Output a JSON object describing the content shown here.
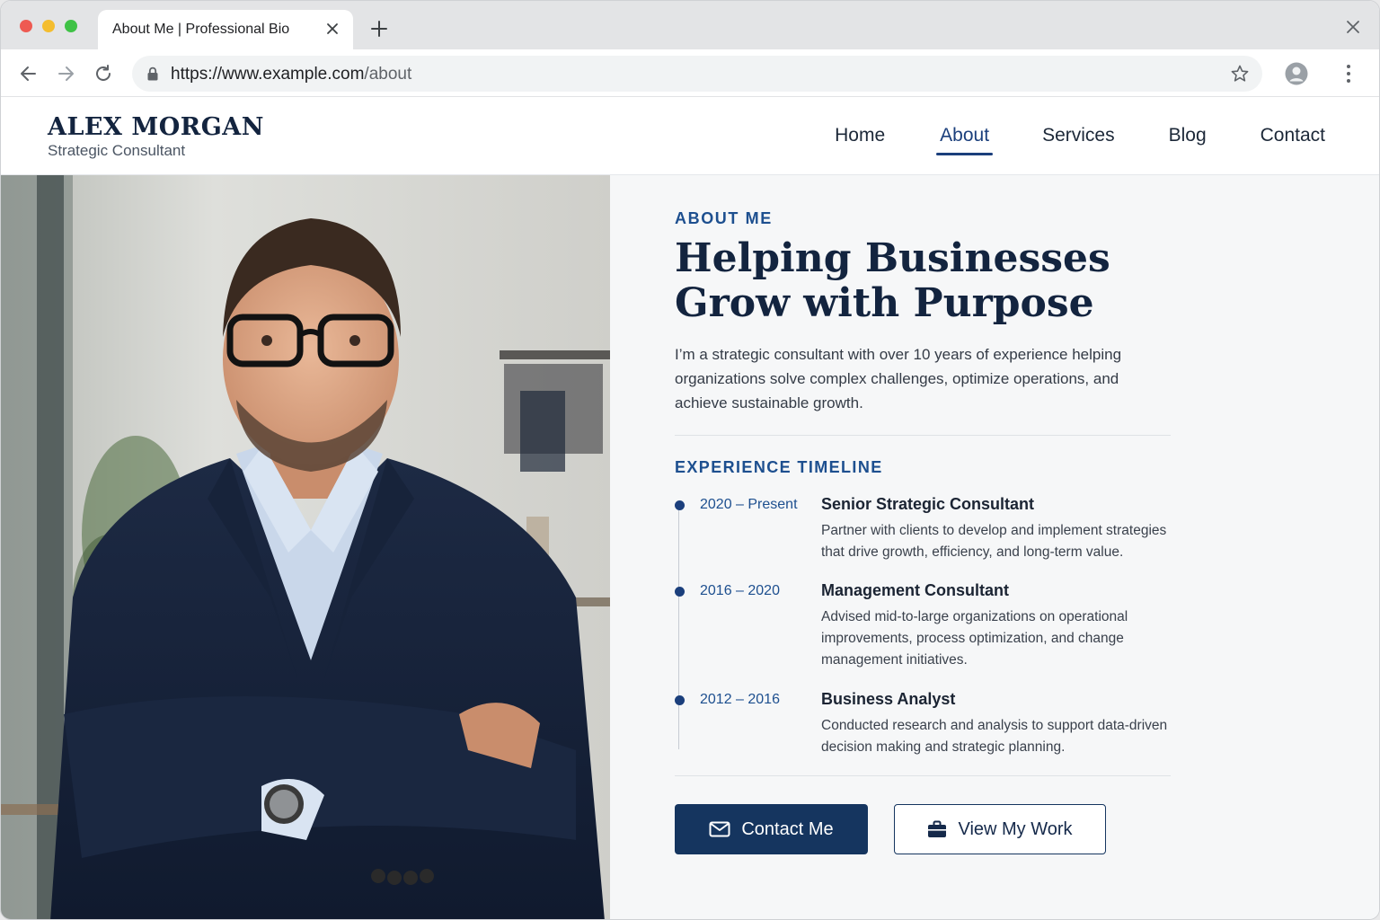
{
  "browser": {
    "tab_title": "About Me | Professional Bio",
    "url_host": "https://www.example.com",
    "url_path": "/about"
  },
  "site": {
    "name": "ALEX MORGAN",
    "role": "Strategic Consultant",
    "nav": [
      {
        "label": "Home",
        "active": false
      },
      {
        "label": "About",
        "active": true
      },
      {
        "label": "Services",
        "active": false
      },
      {
        "label": "Blog",
        "active": false
      },
      {
        "label": "Contact",
        "active": false
      }
    ]
  },
  "about": {
    "eyebrow": "ABOUT ME",
    "headline_line1": "Helping Businesses",
    "headline_line2": "Grow with Purpose",
    "intro": "I’m a strategic consultant with over 10 years of experience helping organizations solve complex challenges, optimize operations, and achieve sustainable growth."
  },
  "timeline": {
    "title": "EXPERIENCE TIMELINE",
    "items": [
      {
        "period": "2020 – Present",
        "role": "Senior Strategic Consultant",
        "desc": "Partner with clients to develop and implement strategies that drive growth, efficiency, and long-term value."
      },
      {
        "period": "2016 – 2020",
        "role": "Management Consultant",
        "desc": "Advised mid-to-large organizations on operational improvements, process optimization, and change management initiatives."
      },
      {
        "period": "2012 – 2016",
        "role": "Business Analyst",
        "desc": "Conducted research and analysis to support data-driven decision making and strategic planning."
      }
    ]
  },
  "actions": {
    "primary_label": "Contact Me",
    "primary_icon": "envelope-icon",
    "secondary_label": "View My Work",
    "secondary_icon": "briefcase-icon"
  },
  "colors": {
    "navy": "#13243f",
    "accent_blue": "#1d4f8f",
    "button_navy": "#15355f"
  }
}
